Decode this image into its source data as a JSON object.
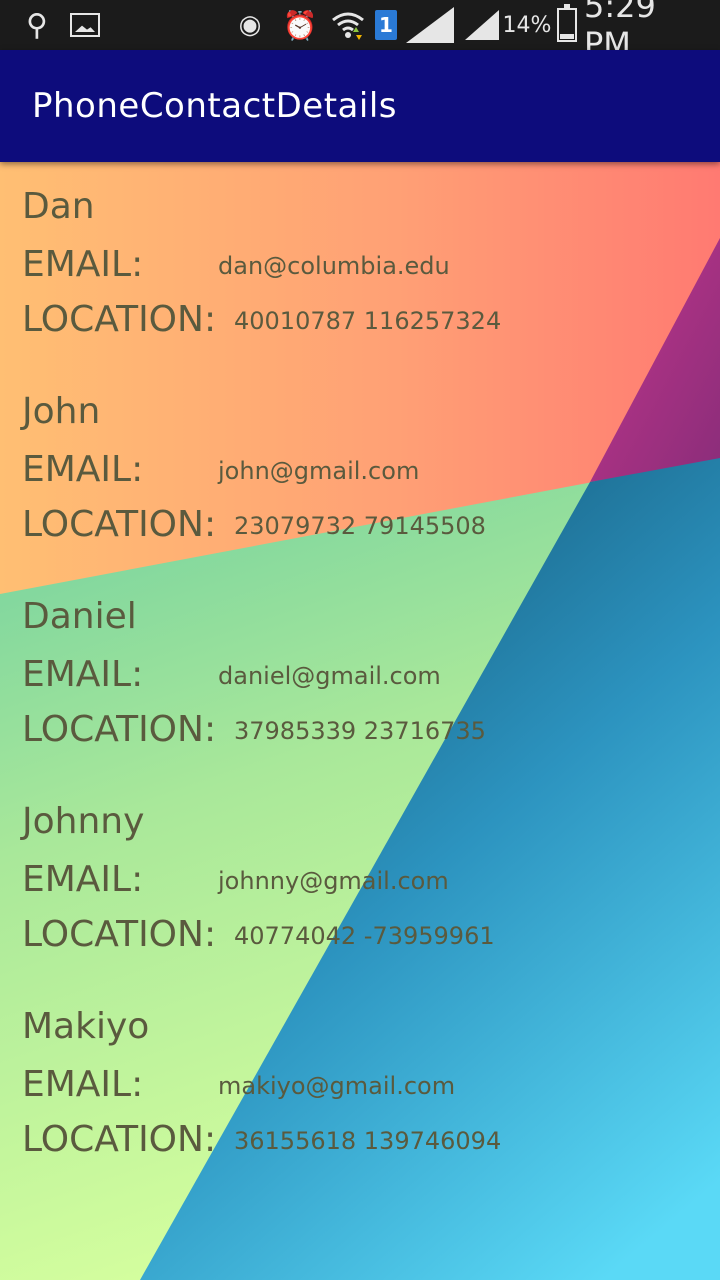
{
  "status_bar": {
    "usb_icon": "usb-icon",
    "gallery_icon": "gallery-icon",
    "eye_icon": "eye-icon",
    "alarm_icon": "alarm-icon",
    "wifi_icon": "wifi-icon",
    "sim_label": "1",
    "battery_percent": "14%",
    "time": "5:29 PM"
  },
  "app_bar": {
    "title": "PhoneContactDetails",
    "color": "#0d0c7c"
  },
  "labels": {
    "email": "EMAIL:",
    "location": "LOCATION:"
  },
  "contacts": [
    {
      "name": "Dan",
      "email": "dan@columbia.edu",
      "location": "40010787 116257324"
    },
    {
      "name": "John",
      "email": "john@gmail.com",
      "location": "23079732 79145508"
    },
    {
      "name": "Daniel",
      "email": "daniel@gmail.com",
      "location": "37985339 23716735"
    },
    {
      "name": "Johnny",
      "email": "johnny@gmail.com",
      "location": "40774042 -73959961"
    },
    {
      "name": "Makiyo",
      "email": "makiyo@gmail.com",
      "location": "36155618 139746094"
    }
  ]
}
